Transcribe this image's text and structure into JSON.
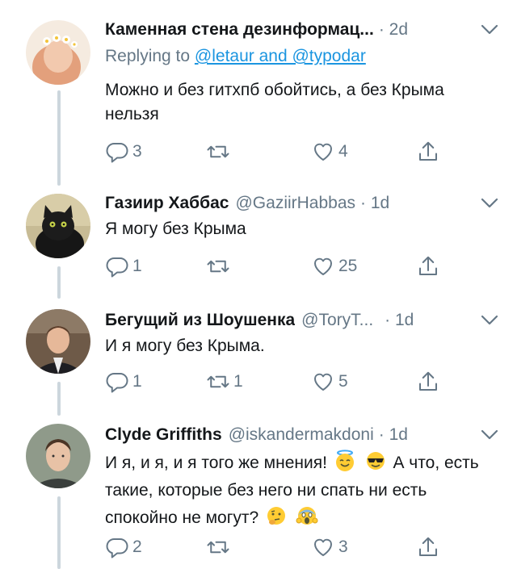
{
  "replies": [
    {
      "name": "Каменная стена дезинформац...",
      "handle": "",
      "time": "· 2d",
      "reply_prefix": "Replying to ",
      "reply_link": "@letaur and @typodar",
      "text": "Можно и без гитхпб обойтись, а без Крыма нельзя",
      "replies": "3",
      "retweets": "",
      "likes": "4",
      "avatar": "flower-crown-avatar"
    },
    {
      "name": "Газиир Хаббас",
      "handle": "@GaziirHabbas",
      "time": "· 1d",
      "text": "Я могу без Крыма",
      "replies": "1",
      "retweets": "",
      "likes": "25",
      "avatar": "black-cat-avatar"
    },
    {
      "name": "Бегущий из Шоушенка",
      "handle": "@ToryT...",
      "time": "· 1d",
      "text": "И я могу без Крыма.",
      "replies": "1",
      "retweets": "1",
      "likes": "5",
      "avatar": "man-in-suit-avatar"
    },
    {
      "name": "Clyde Griffiths",
      "handle": "@iskandermakdoni",
      "time": "· 1d",
      "text_parts": [
        "И я, и я, и я того же мнения!",
        "А что, есть такие, которые без него ни спать ни есть спокойно не могут?"
      ],
      "emojis": [
        "smiling-face-with-halo",
        "smiling-face-with-sunglasses",
        "thinking-face",
        "face-screaming-in-fear"
      ],
      "replies": "2",
      "retweets": "",
      "likes": "3",
      "avatar": "young-man-avatar"
    }
  ],
  "colors": {
    "text": "#14171a",
    "secondary": "#657786",
    "link": "#1b95e0",
    "line": "#ccd6dd"
  }
}
